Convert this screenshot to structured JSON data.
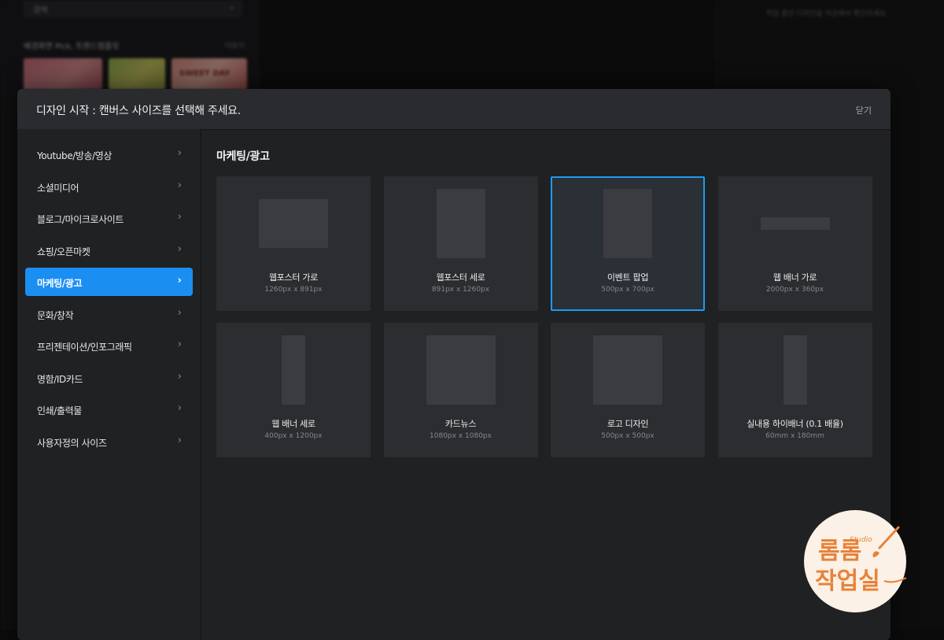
{
  "background": {
    "search_placeholder": "검색",
    "section_title": "배경화면 Pick, 트렌드템플릿",
    "section_more": "더보기",
    "thumb_text": "SWEET DAY",
    "right_text": "작업 중인 디자인을 이곳에서 확인하세요"
  },
  "modal": {
    "title": "디자인 시작 : 캔버스 사이즈를 선택해 주세요.",
    "close_label": "닫기"
  },
  "sidebar": {
    "items": [
      {
        "label": "Youtube/방송/영상",
        "active": false
      },
      {
        "label": "소셜미디어",
        "active": false
      },
      {
        "label": "블로그/마이크로사이트",
        "active": false
      },
      {
        "label": "쇼핑/오픈마켓",
        "active": false
      },
      {
        "label": "마케팅/광고",
        "active": true
      },
      {
        "label": "문화/창작",
        "active": false
      },
      {
        "label": "프리젠테이션/인포그래픽",
        "active": false
      },
      {
        "label": "명함/ID카드",
        "active": false
      },
      {
        "label": "인쇄/출력물",
        "active": false
      },
      {
        "label": "사용자정의 사이즈",
        "active": false
      }
    ],
    "chevron": "›"
  },
  "content": {
    "title": "마케팅/광고",
    "cards": [
      {
        "name": "웹포스터 가로",
        "size": "1260px x 891px",
        "selected": false
      },
      {
        "name": "웹포스터 세로",
        "size": "891px x 1260px",
        "selected": false
      },
      {
        "name": "이벤트 팝업",
        "size": "500px x 700px",
        "selected": true
      },
      {
        "name": "웹 배너 가로",
        "size": "2000px x 360px",
        "selected": false
      },
      {
        "name": "웹 배너 세로",
        "size": "400px x 1200px",
        "selected": false
      },
      {
        "name": "카드뉴스",
        "size": "1080px x 1080px",
        "selected": false
      },
      {
        "name": "로고 디자인",
        "size": "500px x 500px",
        "selected": false
      },
      {
        "name": "실내용 하이배너 (0.1 배율)",
        "size": "60mm x 180mm",
        "selected": false
      }
    ]
  },
  "watermark": {
    "line1": "롬롬",
    "line2": "작업실",
    "small": "Studio"
  },
  "colors": {
    "accent": "#1b8ef2",
    "selected_border": "#1e9bf0",
    "modal_bg": "#202123",
    "card_bg": "#2c2d30",
    "logo_orange": "#e8823a"
  }
}
